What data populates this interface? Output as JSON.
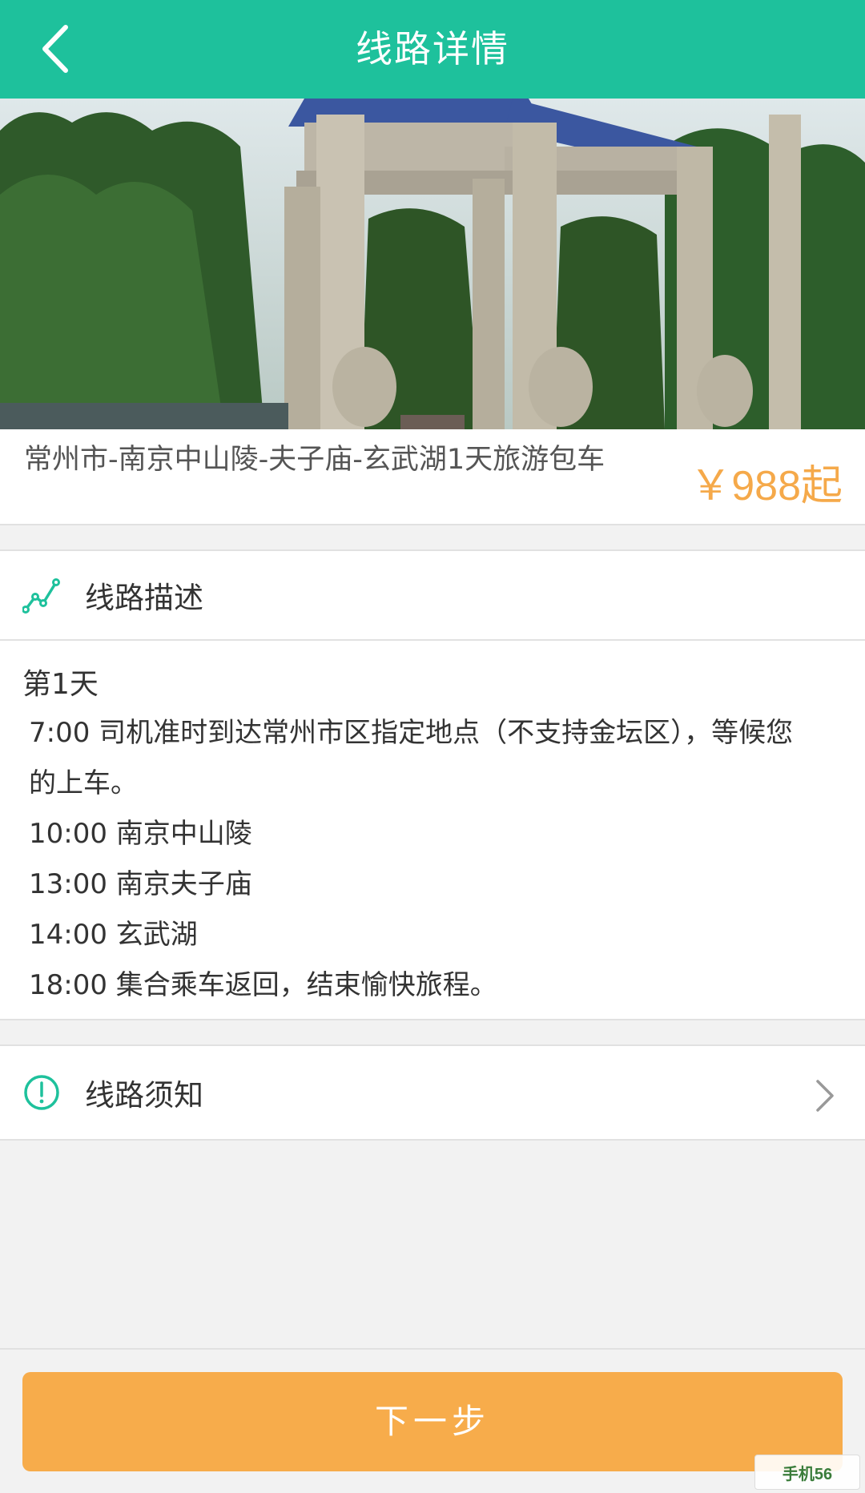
{
  "header": {
    "title": "线路详情",
    "back_icon": "chevron-left-icon",
    "bg_color": "#1ec19c"
  },
  "hero": {
    "image_icon": "memorial-gate-photo"
  },
  "product": {
    "name": "常州市-南京中山陵-夫子庙-玄武湖1天旅游包车",
    "price": "￥988起",
    "price_color": "#f5a94a"
  },
  "route_description": {
    "icon": "line-chart-icon",
    "label": "线路描述",
    "day": "第1天",
    "lines": [
      "7:00 司机准时到达常州市区指定地点（不支持金坛区），等候您",
      "的上车。",
      "10:00 南京中山陵",
      "13:00 南京夫子庙",
      "14:00 玄武湖",
      "18:00 集合乘车返回，结束愉快旅程。"
    ]
  },
  "route_notice": {
    "icon": "exclamation-circle-icon",
    "label": "线路须知",
    "arrow_icon": "chevron-right-icon"
  },
  "footer": {
    "next_label": "下一步",
    "button_color": "#f7ac4b"
  },
  "watermark": {
    "text": "手机56"
  }
}
